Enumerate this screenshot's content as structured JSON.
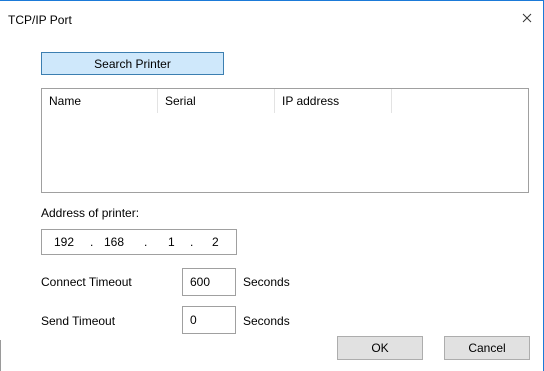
{
  "dialog": {
    "title": "TCP/IP Port",
    "close_icon": "close-icon"
  },
  "search": {
    "button_label": "Search Printer"
  },
  "printer_list": {
    "columns": [
      "Name",
      "Serial",
      "IP address",
      ""
    ],
    "rows": []
  },
  "address": {
    "label": "Address of printer:",
    "octets": [
      "192",
      "168",
      "1",
      "2"
    ],
    "separator": "."
  },
  "connect_timeout": {
    "label": "Connect Timeout",
    "value": "600",
    "unit": "Seconds"
  },
  "send_timeout": {
    "label": "Send Timeout",
    "value": "0",
    "unit": "Seconds"
  },
  "buttons": {
    "ok": "OK",
    "cancel": "Cancel"
  },
  "colors": {
    "accent_border": "#1b7ad8",
    "search_button_bg": "#cfe8fb"
  }
}
